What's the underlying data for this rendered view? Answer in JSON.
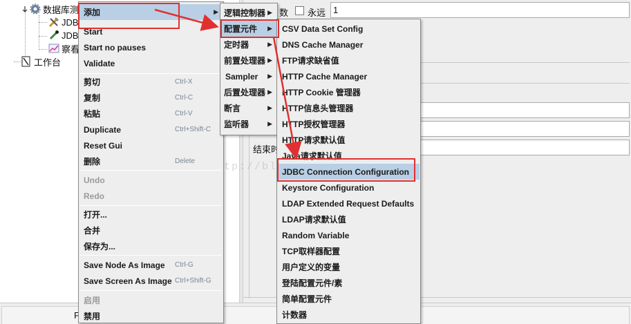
{
  "tree": {
    "root_label": "数据库测",
    "child1_label": "JDB",
    "child2_label": "JDB",
    "child3_label": "察看",
    "workbench_label": "工作台"
  },
  "right_panel": {
    "count_suffix": "数",
    "forever_label": "永远",
    "loop_value": "1",
    "end_time_label": "结束时"
  },
  "bottom_bar": {
    "text": "F"
  },
  "context_menu": {
    "items": [
      {
        "label": "添加",
        "submenu": true,
        "highlighted": true
      },
      {
        "label": "Start"
      },
      {
        "label": "Start no pauses"
      },
      {
        "label": "Validate"
      },
      {
        "label": "剪切",
        "shortcut": "Ctrl-X"
      },
      {
        "label": "复制",
        "shortcut": "Ctrl-C"
      },
      {
        "label": "粘贴",
        "shortcut": "Ctrl-V"
      },
      {
        "label": "Duplicate",
        "shortcut": "Ctrl+Shift-C"
      },
      {
        "label": "Reset Gui"
      },
      {
        "label": "删除",
        "shortcut": "Delete"
      },
      {
        "label": "Undo",
        "disabled": true
      },
      {
        "label": "Redo",
        "disabled": true
      },
      {
        "label": "打开..."
      },
      {
        "label": "合并"
      },
      {
        "label": "保存为..."
      },
      {
        "label": "Save Node As Image",
        "shortcut": "Ctrl-G"
      },
      {
        "label": "Save Screen As Image",
        "shortcut": "Ctrl+Shift-G"
      },
      {
        "label": "启用",
        "disabled": true
      },
      {
        "label": "禁用"
      }
    ]
  },
  "add_submenu": {
    "items": [
      {
        "label": "逻辑控制器"
      },
      {
        "label": "配置元件",
        "highlighted": true
      },
      {
        "label": "定时器"
      },
      {
        "label": "前置处理器"
      },
      {
        "label": "Sampler"
      },
      {
        "label": "后置处理器"
      },
      {
        "label": "断言"
      },
      {
        "label": "监听器"
      }
    ]
  },
  "config_submenu": {
    "items": [
      {
        "label": "CSV Data Set Config"
      },
      {
        "label": "DNS Cache Manager"
      },
      {
        "label": "FTP请求缺省值"
      },
      {
        "label": "HTTP Cache Manager"
      },
      {
        "label": "HTTP Cookie 管理器"
      },
      {
        "label": "HTTP信息头管理器"
      },
      {
        "label": "HTTP授权管理器"
      },
      {
        "label": "HTTP请求默认值"
      },
      {
        "label": "Java请求默认值"
      },
      {
        "label": "JDBC Connection Configuration",
        "highlighted": true
      },
      {
        "label": "Keystore Configuration"
      },
      {
        "label": "LDAP Extended Request Defaults"
      },
      {
        "label": "LDAP请求默认值"
      },
      {
        "label": "Random Variable"
      },
      {
        "label": "TCP取样器配置"
      },
      {
        "label": "用户定义的变量"
      },
      {
        "label": "登陆配置元件/素"
      },
      {
        "label": "简单配置元件"
      },
      {
        "label": "计数器"
      }
    ]
  },
  "watermark": "http://blog.csdn.net/hei",
  "colors": {
    "highlight": "#b8cfe5",
    "annotation_red": "#e03030",
    "menu_bg": "#eeeeee"
  }
}
